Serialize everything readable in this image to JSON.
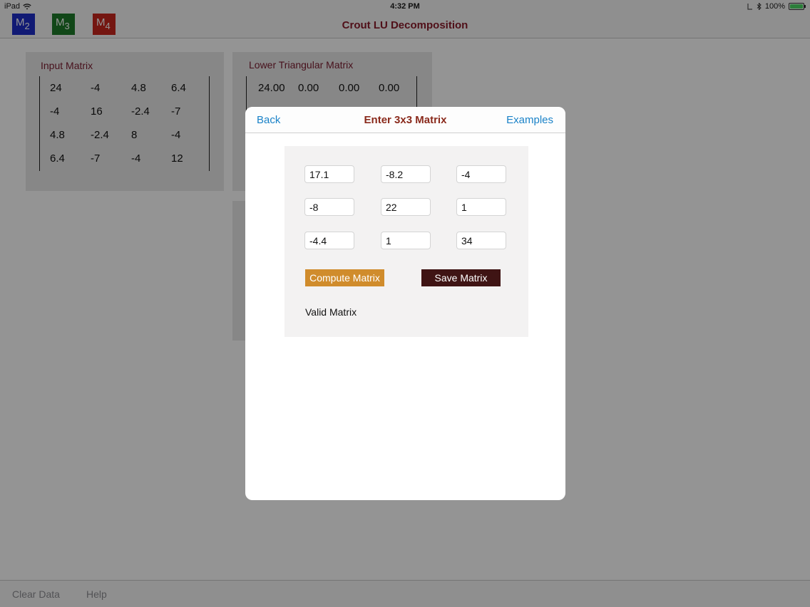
{
  "status_bar": {
    "device": "iPad",
    "time": "4:32 PM",
    "battery_text": "100%",
    "battery_level": 1.0
  },
  "nav": {
    "title": "Crout LU Decomposition",
    "matrix_buttons": [
      {
        "letter": "M",
        "sub": "2",
        "color": "#1e2ec8"
      },
      {
        "letter": "M",
        "sub": "3",
        "color": "#1e7a2a"
      },
      {
        "letter": "M",
        "sub": "4",
        "color": "#c8261e"
      }
    ]
  },
  "input_matrix": {
    "title": "Input Matrix",
    "rows": [
      [
        "24",
        "-4",
        "4.8",
        "6.4"
      ],
      [
        "-4",
        "16",
        "-2.4",
        "-7"
      ],
      [
        "4.8",
        "-2.4",
        "8",
        "-4"
      ],
      [
        "6.4",
        "-7",
        "-4",
        "12"
      ]
    ]
  },
  "lower_matrix": {
    "title": "Lower Triangular Matrix",
    "rows": [
      [
        "24.00",
        "0.00",
        "0.00",
        "0.00"
      ]
    ]
  },
  "tab_bar": {
    "clear_label": "Clear Data",
    "help_label": "Help"
  },
  "modal": {
    "back_label": "Back",
    "title": "Enter 3x3 Matrix",
    "examples_label": "Examples",
    "cells": [
      [
        "17.1",
        "-8.2",
        "-4"
      ],
      [
        "-8",
        "22",
        "1"
      ],
      [
        "-4.4",
        "1",
        "34"
      ]
    ],
    "compute_label": "Compute Matrix",
    "save_label": "Save Matrix",
    "status_text": "Valid Matrix"
  }
}
